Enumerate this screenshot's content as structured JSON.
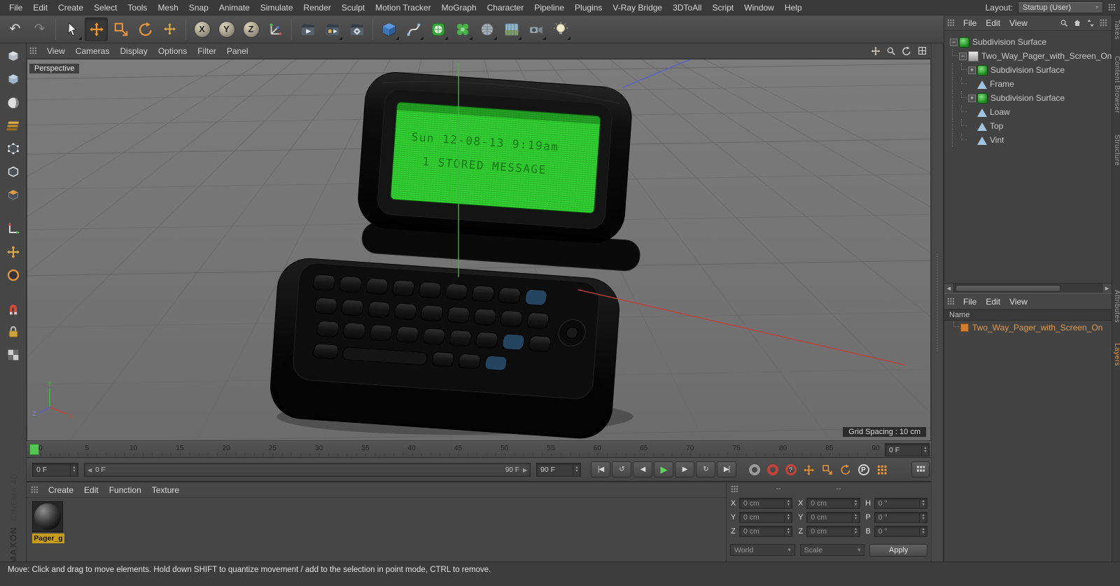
{
  "menubar": {
    "items": [
      "File",
      "Edit",
      "Create",
      "Select",
      "Tools",
      "Mesh",
      "Snap",
      "Animate",
      "Simulate",
      "Render",
      "Sculpt",
      "Motion Tracker",
      "MoGraph",
      "Character",
      "Pipeline",
      "Plugins",
      "V-Ray Bridge",
      "3DToAll",
      "Script",
      "Window",
      "Help"
    ],
    "layout_label": "Layout:",
    "layout_value": "Startup (User)"
  },
  "toolbar": {
    "active": "move",
    "icons": [
      "undo",
      "redo",
      "live-selection",
      "move",
      "scale",
      "rotate",
      "last-tool",
      "lock-x-axis",
      "lock-y-axis",
      "lock-z-axis",
      "coordinate-system",
      "render-view",
      "render-picture-viewer",
      "edit-render-settings",
      "add-primitive",
      "add-spline",
      "add-generator",
      "add-mograph",
      "add-deformer",
      "add-environment",
      "add-camera",
      "add-light"
    ],
    "axis_letters": {
      "lock-x-axis": "X",
      "lock-y-axis": "Y",
      "lock-z-axis": "Z"
    }
  },
  "left_toolbar": {
    "icons": [
      "make-editable",
      "model-mode",
      "texture-mode",
      "workplane-mode",
      "points-mode",
      "edges-mode",
      "polygons-mode",
      "axis-mode",
      "enable-axis",
      "viewport-solo",
      "snap-settings",
      "lock-workplane",
      "quantize"
    ]
  },
  "viewport": {
    "menus": [
      "View",
      "Cameras",
      "Display",
      "Options",
      "Filter",
      "Panel"
    ],
    "corner_icons": [
      "pan-view",
      "zoom-view",
      "rotate-view",
      "toggle-view"
    ],
    "label": "Perspective",
    "grid_spacing": "Grid Spacing : 10 cm",
    "axis_gizmo": {
      "x": "X",
      "y": "Y",
      "z": "Z"
    },
    "pager_screen": {
      "line1": "Sun 12-08-13  9:19am",
      "line2": "1 STORED MESSAGE"
    }
  },
  "timeline": {
    "ticks": [
      "0",
      "5",
      "10",
      "15",
      "20",
      "25",
      "30",
      "35",
      "40",
      "45",
      "50",
      "55",
      "60",
      "65",
      "70",
      "75",
      "80",
      "85",
      "90"
    ],
    "ruler_frame_field": "0 F",
    "current_frame_field": "0 F",
    "range_start_label": "0 F",
    "range_end_label": "90 F",
    "end_frame_field": "90 F",
    "transport": [
      "goto-start",
      "previous-key",
      "previous-frame",
      "play-forward",
      "next-frame",
      "next-key",
      "goto-end"
    ],
    "record_buttons": [
      "record-active-objects",
      "autokeying",
      "keyframe-selection",
      "record-position",
      "record-scale",
      "record-rotation",
      "record-parameter",
      "record-pla"
    ]
  },
  "materials": {
    "menus": [
      "Create",
      "Edit",
      "Function",
      "Texture"
    ],
    "items": [
      {
        "name": "Pager_g"
      }
    ]
  },
  "coordinates": {
    "header_dashes": [
      "--",
      "--"
    ],
    "position": [
      {
        "label": "X",
        "value": "0 cm"
      },
      {
        "label": "Y",
        "value": "0 cm"
      },
      {
        "label": "Z",
        "value": "0 cm"
      }
    ],
    "size": [
      {
        "label": "X",
        "value": "0 cm"
      },
      {
        "label": "Y",
        "value": "0 cm"
      },
      {
        "label": "Z",
        "value": "0 cm"
      }
    ],
    "rotation": [
      {
        "label": "H",
        "value": "0 °"
      },
      {
        "label": "P",
        "value": "0 °"
      },
      {
        "label": "B",
        "value": "0 °"
      }
    ],
    "system_dropdown": "World",
    "size_dropdown": "Scale",
    "apply_label": "Apply"
  },
  "object_manager": {
    "menus": [
      "File",
      "Edit",
      "View"
    ],
    "header_icons": [
      "search",
      "home",
      "updown",
      "grip"
    ],
    "tree": [
      {
        "label": "Subdivision Surface",
        "depth": 0,
        "expander": "minus",
        "icon": "subdivision"
      },
      {
        "label": "Two_Way_Pager_with_Screen_On",
        "depth": 1,
        "expander": "minus",
        "icon": "object"
      },
      {
        "label": "Subdivision Surface",
        "depth": 2,
        "expander": "plus",
        "icon": "subdivision"
      },
      {
        "label": "Frame",
        "depth": 2,
        "expander": null,
        "icon": "mesh"
      },
      {
        "label": "Subdivision Surface",
        "depth": 2,
        "expander": "plus",
        "icon": "subdivision"
      },
      {
        "label": "Loaw",
        "depth": 2,
        "expander": null,
        "icon": "mesh"
      },
      {
        "label": "Top",
        "depth": 2,
        "expander": null,
        "icon": "mesh"
      },
      {
        "label": "Vint",
        "depth": 2,
        "expander": null,
        "icon": "mesh"
      }
    ]
  },
  "layer_manager": {
    "menus": [
      "File",
      "Edit",
      "View"
    ],
    "name_header": "Name",
    "items": [
      {
        "label": "Two_Way_Pager_with_Screen_On"
      }
    ]
  },
  "side_tabs": {
    "top": [
      "Takes",
      "Content Browser",
      "Structure"
    ],
    "bottom": [
      "Attributes",
      "Layers"
    ],
    "active": "Layers"
  },
  "statusbar": {
    "text": "Move: Click and drag to move elements. Hold down SHIFT to quantize movement / add to the selection in point mode, CTRL to remove."
  },
  "branding": {
    "line1": "MAXON",
    "line2": "CINEMA 4D"
  },
  "colors": {
    "accent_orange": "#e8953c",
    "selection_yellow": "#c79d18",
    "axis_green": "#46b34a",
    "axis_red": "#bf4038",
    "axis_blue": "#5a60c6",
    "screen_green": "#35d435"
  }
}
